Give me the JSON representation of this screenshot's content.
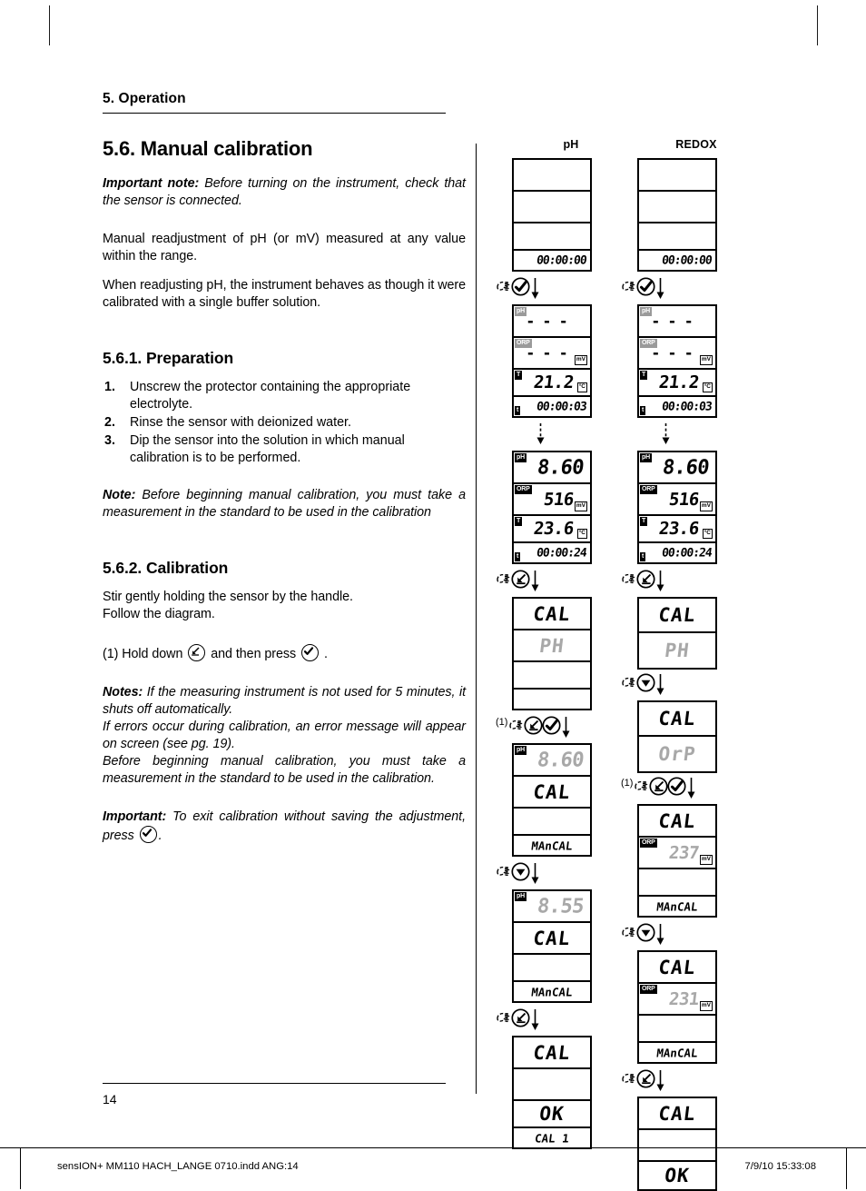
{
  "meta": {
    "page_number": "14",
    "footer_left": "sensION+ MM110 HACH_LANGE 0710.indd   ANG:14",
    "footer_right": "7/9/10   15:33:08"
  },
  "chapter": {
    "title": "5. Operation"
  },
  "sections": {
    "manual_calibration": {
      "heading": "5.6. Manual calibration",
      "important_note_label": "Important note:",
      "important_note_text": " Before turning on the instrument, check that the sensor is connected.",
      "para1": "Manual readjustment of pH (or mV) measured at any value within the range.",
      "para2": "When readjusting pH, the instrument behaves as though it were calibrated with a single buffer solution."
    },
    "preparation": {
      "heading": "5.6.1. Preparation",
      "steps": [
        {
          "num": "1.",
          "text": "Unscrew the protector containing the appropriate electrolyte."
        },
        {
          "num": "2.",
          "text": "Rinse the sensor with deionized water."
        },
        {
          "num": "3.",
          "text": "Dip the sensor into the solution in which manual calibration is to be performed."
        }
      ],
      "note_label": "Note:",
      "note_text": " Before beginning manual calibration, you must take a measurement in the standard to be used in the calibration"
    },
    "calibration": {
      "heading": "5.6.2. Calibration",
      "para1": "Stir gently holding the sensor by the handle.",
      "para2": "Follow the diagram.",
      "step1_prefix": "(1) Hold down",
      "step1_middle": "and then press",
      "step1_suffix": ".",
      "notes_label": "Notes:",
      "notes_text1": " If the measuring instrument is not used for 5 minutes, it shuts off automatically.",
      "notes_text2": "If errors occur during calibration, an error message will appear on screen (see pg. 19).",
      "notes_text3": "Before beginning manual calibration, you must take a measurement in the standard to be used in the calibration.",
      "important_label": "Important:",
      "important_text": " To exit calibration without saving the adjustment, press",
      "important_suffix": "."
    }
  },
  "diagram": {
    "columns": [
      {
        "id": "ph",
        "title": "pH"
      },
      {
        "id": "redox",
        "title": "REDOX"
      }
    ],
    "icons": {
      "enter_key": "enter-arrow-key-icon",
      "check_key": "check-key-icon",
      "down_key": "down-arrow-key-icon",
      "hand": "hand-pointer-icon",
      "flow_arrow": "down-flow-arrow-icon"
    },
    "ph_flow": [
      {
        "step": "ph-screen-1",
        "rows": [
          {
            "tag": "",
            "value": "",
            "unit": ""
          },
          {
            "tag": "",
            "value": "",
            "unit": ""
          },
          {
            "tag": "",
            "value": "",
            "unit": ""
          },
          {
            "tag": "",
            "value": "00:00:00",
            "unit": ""
          }
        ]
      },
      {
        "step": "ph-screen-2",
        "transition": {
          "keys": [
            "check-key-icon"
          ],
          "label": ""
        },
        "rows": [
          {
            "tag": "pH",
            "tag_style": "grey",
            "value": "- - -",
            "unit": ""
          },
          {
            "tag": "ORP",
            "tag_style": "grey",
            "value": "- - -",
            "unit": "mV"
          },
          {
            "tag": "T",
            "tag_style": "black",
            "value": "21.2",
            "unit": "°C"
          },
          {
            "tag": "t",
            "tag_style": "black",
            "value": "00:00:03",
            "unit": ""
          }
        ]
      },
      {
        "step": "ph-screen-3",
        "transition": {
          "keys": [],
          "label": ""
        },
        "rows": [
          {
            "tag": "pH",
            "tag_style": "black",
            "value": "8.60",
            "unit": ""
          },
          {
            "tag": "ORP",
            "tag_style": "black",
            "value": "516",
            "unit": "mV"
          },
          {
            "tag": "T",
            "tag_style": "black",
            "value": "23.6",
            "unit": "°C"
          },
          {
            "tag": "t",
            "tag_style": "black",
            "value": "00:00:24",
            "unit": ""
          }
        ]
      },
      {
        "step": "ph-screen-4",
        "transition": {
          "keys": [
            "enter-arrow-key-icon"
          ],
          "label": ""
        },
        "rows": [
          {
            "tag": "",
            "value": "CAL",
            "unit": "",
            "word": true
          },
          {
            "tag": "",
            "value": "PH",
            "unit": "",
            "word": true,
            "dim": true
          },
          {
            "tag": "",
            "value": "",
            "unit": ""
          },
          {
            "tag": "",
            "value": "",
            "unit": ""
          }
        ]
      },
      {
        "step": "ph-screen-5",
        "transition": {
          "keys": [
            "enter-arrow-key-icon",
            "check-key-icon"
          ],
          "label": "(1)"
        },
        "rows": [
          {
            "tag": "pH",
            "tag_style": "black",
            "value": "8.60",
            "unit": "",
            "dim": true
          },
          {
            "tag": "",
            "value": "CAL",
            "unit": "",
            "word": true
          },
          {
            "tag": "",
            "value": "",
            "unit": ""
          },
          {
            "tag": "",
            "value": "MAnCAL",
            "unit": "",
            "wordsm": true
          }
        ]
      },
      {
        "step": "ph-screen-6",
        "transition": {
          "keys": [
            "down-arrow-key-icon"
          ],
          "label": ""
        },
        "rows": [
          {
            "tag": "pH",
            "tag_style": "black",
            "value": "8.55",
            "unit": "",
            "dim": true
          },
          {
            "tag": "",
            "value": "CAL",
            "unit": "",
            "word": true
          },
          {
            "tag": "",
            "value": "",
            "unit": ""
          },
          {
            "tag": "",
            "value": "MAnCAL",
            "unit": "",
            "wordsm": true
          }
        ]
      },
      {
        "step": "ph-screen-7",
        "transition": {
          "keys": [
            "enter-arrow-key-icon"
          ],
          "label": ""
        },
        "rows": [
          {
            "tag": "",
            "value": "CAL",
            "unit": "",
            "word": true
          },
          {
            "tag": "",
            "value": "",
            "unit": ""
          },
          {
            "tag": "",
            "value": "OK",
            "unit": "",
            "word": true
          },
          {
            "tag": "",
            "value": "CAL 1",
            "unit": "",
            "wordsm": true
          }
        ]
      }
    ],
    "redox_flow": [
      {
        "step": "redox-screen-1",
        "rows": [
          {
            "tag": "",
            "value": "",
            "unit": ""
          },
          {
            "tag": "",
            "value": "",
            "unit": ""
          },
          {
            "tag": "",
            "value": "",
            "unit": ""
          },
          {
            "tag": "",
            "value": "00:00:00",
            "unit": ""
          }
        ]
      },
      {
        "step": "redox-screen-2",
        "transition": {
          "keys": [
            "check-key-icon"
          ],
          "label": ""
        },
        "rows": [
          {
            "tag": "pH",
            "tag_style": "grey",
            "value": "- - -",
            "unit": ""
          },
          {
            "tag": "ORP",
            "tag_style": "grey",
            "value": "- - -",
            "unit": "mV"
          },
          {
            "tag": "T",
            "tag_style": "black",
            "value": "21.2",
            "unit": "°C"
          },
          {
            "tag": "t",
            "tag_style": "black",
            "value": "00:00:03",
            "unit": ""
          }
        ]
      },
      {
        "step": "redox-screen-3",
        "transition": {
          "keys": [],
          "label": ""
        },
        "rows": [
          {
            "tag": "pH",
            "tag_style": "black",
            "value": "8.60",
            "unit": ""
          },
          {
            "tag": "ORP",
            "tag_style": "black",
            "value": "516",
            "unit": "mV"
          },
          {
            "tag": "T",
            "tag_style": "black",
            "value": "23.6",
            "unit": "°C"
          },
          {
            "tag": "t",
            "tag_style": "black",
            "value": "00:00:24",
            "unit": ""
          }
        ]
      },
      {
        "step": "redox-screen-4",
        "transition": {
          "keys": [
            "enter-arrow-key-icon"
          ],
          "label": ""
        },
        "rows": [
          {
            "tag": "",
            "value": "CAL",
            "unit": "",
            "word": true
          },
          {
            "tag": "",
            "value": "PH",
            "unit": "",
            "word": true,
            "dim": true
          }
        ]
      },
      {
        "step": "redox-screen-5",
        "transition": {
          "keys": [
            "down-arrow-key-icon"
          ],
          "label": ""
        },
        "rows": [
          {
            "tag": "",
            "value": "CAL",
            "unit": "",
            "word": true
          },
          {
            "tag": "",
            "value": "OrP",
            "unit": "",
            "word": true,
            "dim": true
          }
        ]
      },
      {
        "step": "redox-screen-6",
        "transition": {
          "keys": [
            "enter-arrow-key-icon",
            "check-key-icon"
          ],
          "label": "(1)"
        },
        "rows": [
          {
            "tag": "",
            "value": "CAL",
            "unit": "",
            "word": true
          },
          {
            "tag": "ORP",
            "tag_style": "black",
            "value": "237",
            "unit": "mV",
            "dim": true
          },
          {
            "tag": "",
            "value": "",
            "unit": ""
          },
          {
            "tag": "",
            "value": "MAnCAL",
            "unit": "",
            "wordsm": true
          }
        ]
      },
      {
        "step": "redox-screen-7",
        "transition": {
          "keys": [
            "down-arrow-key-icon"
          ],
          "label": ""
        },
        "rows": [
          {
            "tag": "",
            "value": "CAL",
            "unit": "",
            "word": true
          },
          {
            "tag": "ORP",
            "tag_style": "black",
            "value": "231",
            "unit": "mV",
            "dim": true
          },
          {
            "tag": "",
            "value": "",
            "unit": ""
          },
          {
            "tag": "",
            "value": "MAnCAL",
            "unit": "",
            "wordsm": true
          }
        ]
      },
      {
        "step": "redox-screen-8",
        "transition": {
          "keys": [
            "enter-arrow-key-icon"
          ],
          "label": ""
        },
        "rows": [
          {
            "tag": "",
            "value": "CAL",
            "unit": "",
            "word": true
          },
          {
            "tag": "",
            "value": "",
            "unit": ""
          },
          {
            "tag": "",
            "value": "OK",
            "unit": "",
            "word": true
          }
        ]
      }
    ]
  }
}
